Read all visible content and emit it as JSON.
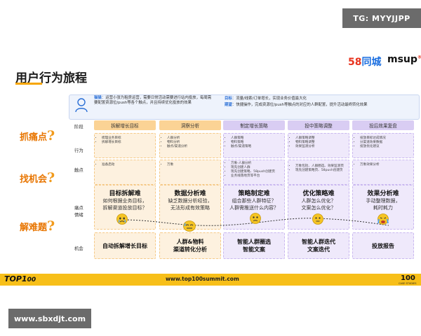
{
  "watermark_top": "TG: MYYJJPP",
  "watermark_bottom": "www.sbxdjt.com",
  "title": "用户行为旅程",
  "logos": {
    "brand_58_num": "58",
    "brand_58_text": "同城",
    "brand_msup": "msup",
    "brand_msup_mark": "®"
  },
  "persona": {
    "role_tag": "猫猫",
    "role_text": "：运营小张为租房运营，需要日常活动需要进行站内投放，每周需要配置资源位/push等各个触点，并且持续优化投放的效果",
    "goal_tag": "目标",
    "goal_text": "：流量/线索/订单增长，实现业务价值最大化",
    "pain_tag": "期望",
    "pain_text": "：快捷操作，完成资源位/push等触点的对应的人群配置，提升活动最终转化效果"
  },
  "side_labels": [
    {
      "text": "抓痛点",
      "q": "?"
    },
    {
      "text": "找机会",
      "q": "?"
    },
    {
      "text": "解难题",
      "q": "?"
    }
  ],
  "row_labels": {
    "stage": "阶段",
    "action": "行为",
    "touch": "触点",
    "pain_1": "痛点",
    "pain_2": "情绪",
    "opportunity": "机会"
  },
  "stages": [
    {
      "name": "拆解增长目标",
      "color": "orange",
      "actions": [
        "梳理业务目标",
        "拆解增长目标"
      ],
      "touches": [
        "准备启动"
      ],
      "pain_title": "目标拆解难",
      "pain_desc": [
        "如何根据业务目标，",
        "拆解渠道投放目标？"
      ],
      "opportunity": [
        "自动拆解增长目标"
      ]
    },
    {
      "name": "洞察分析",
      "color": "orange",
      "actions": [
        "人群分析",
        "物料分析",
        "触点/渠道分析"
      ],
      "touches": [
        "万象"
      ],
      "pain_title": "数据分析难",
      "pain_desc": [
        "缺乏数据分析经验，",
        "无法形成有效策略"
      ],
      "opportunity": [
        "人群&物料",
        "渠道转化分析"
      ]
    },
    {
      "name": "制定增长策略",
      "color": "purple",
      "actions": [
        "人群策略",
        "物料策略",
        "触点/渠道策略"
      ],
      "touches": [
        "万象-人群分析",
        "现先创建人群",
        "现先创建策略、58push创建页",
        "业务线落地页等平台"
      ],
      "pain_title": "策略制定难",
      "pain_desc": [
        "组合那些人群特征？",
        "人群需推送什么内容？"
      ],
      "opportunity": [
        "智能人群圈选",
        "智能文案"
      ]
    },
    {
      "name": "投中策略调整",
      "color": "purple",
      "actions": [
        "人群策略调整",
        "物料策略调整",
        "效果监测分析"
      ],
      "touches": [
        "万象包括、人群圈选、效果监测页",
        "现先创建策略页、58push创建页"
      ],
      "pain_title": "优化策略难",
      "pain_desc": [
        "人群怎么优化？",
        "文案怎么优化？"
      ],
      "opportunity": [
        "智能人群迭代",
        "文案迭代"
      ]
    },
    {
      "name": "投后效果复盘",
      "color": "purple",
      "actions": [
        "投放目标达成情况",
        "分渠道效果数据",
        "投放优化建议"
      ],
      "touches": [
        "万象效果分析"
      ],
      "pain_title": "效果分析难",
      "pain_desc": [
        "手动整理数据，",
        "耗时耗力"
      ],
      "opportunity": [
        "投放报告"
      ]
    }
  ],
  "footer": {
    "left": "TOP1",
    "left_mark": "00",
    "url": "www.top100summit.com",
    "right": "100",
    "right_sub": "CASE STUDIES"
  },
  "colors": {
    "accent": "#f7bf19",
    "orange_stage": "#fbd395",
    "purple_stage": "#d9cdf3",
    "title_orange": "#e87500"
  }
}
